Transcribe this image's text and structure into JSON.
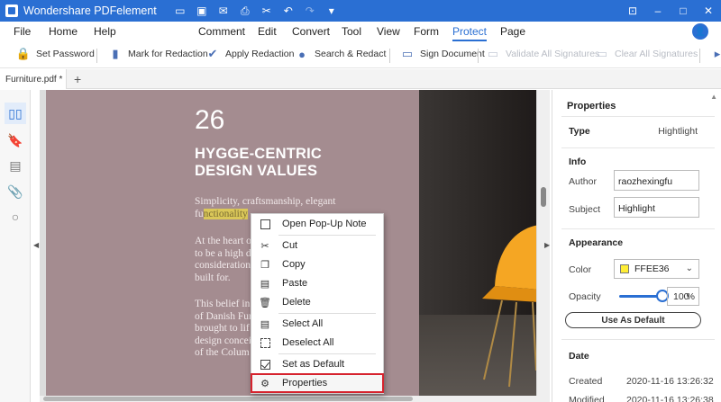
{
  "titlebar": {
    "app_name": "Wondershare PDFelement",
    "quick_icons": [
      "folder-icon",
      "save-icon",
      "mail-icon",
      "print-icon",
      "scissors-icon",
      "undo-icon",
      "redo-icon",
      "dropdown-arrow-icon"
    ]
  },
  "menu": {
    "items": [
      "File",
      "Home",
      "Help",
      "Comment",
      "Edit",
      "Convert",
      "Tool",
      "View",
      "Form",
      "Protect",
      "Page"
    ],
    "active": "Protect"
  },
  "ribbon": {
    "set_password": "Set Password",
    "mark_redaction": "Mark for Redaction",
    "apply_redaction": "Apply Redaction",
    "search_redact": "Search & Redact",
    "sign_document": "Sign Document",
    "validate_signatures": "Validate All Signatures",
    "clear_signatures": "Clear All Signatures"
  },
  "tabs": {
    "doc_tab": "Furniture.pdf *",
    "add": "+"
  },
  "document": {
    "page_number": "26",
    "heading": "HYGGE-CENTRIC\nDESIGN VALUES",
    "para1_line1": "Simplicity, craftsmanship, elegant",
    "para1_l2_pre": "fu",
    "para1_l2_hl": "nctionality",
    "para1_l2_post": "",
    "para2": "At the heart o\nto be a high d\nconsideration\nbuilt for.",
    "para3": "This belief in\nof Danish Fur\nbrought to lif\ndesign concei\nof the Colum"
  },
  "context_menu": {
    "open_popup": "Open Pop-Up Note",
    "cut": "Cut",
    "copy": "Copy",
    "paste": "Paste",
    "delete": "Delete",
    "select_all": "Select All",
    "deselect_all": "Deselect All",
    "set_default": "Set as Default",
    "properties": "Properties"
  },
  "properties": {
    "title": "Properties",
    "type_label": "Type",
    "type_value": "Hightlight",
    "info_header": "Info",
    "author_label": "Author",
    "author_value": "raozhexingfu",
    "subject_label": "Subject",
    "subject_value": "Highlight",
    "appearance_header": "Appearance",
    "color_label": "Color",
    "color_value": "FFEE36",
    "color_hex": "#FFEE36",
    "opacity_label": "Opacity",
    "opacity_value": "100",
    "opacity_unit": "%",
    "opacity_fraction": 1.0,
    "default_button": "Use As Default",
    "date_header": "Date",
    "created_label": "Created",
    "created_value": "2020-11-16 13:26:32",
    "modified_label": "Modified",
    "modified_value": "2020-11-16 13:26:38"
  },
  "colors": {
    "accent": "#2a6fd3",
    "page_bg": "#a48c90",
    "highlight_outline": "#d6232e"
  }
}
